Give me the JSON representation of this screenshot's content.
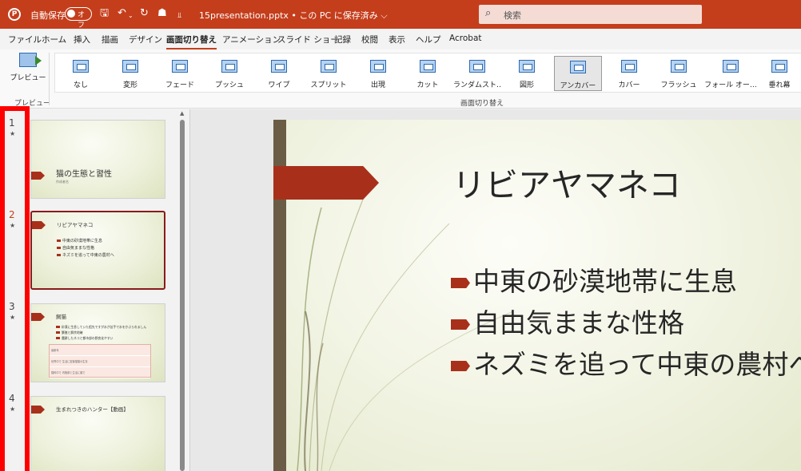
{
  "titlebar": {
    "logo": "P",
    "autosave_label": "自動保存",
    "autosave_state": "オフ",
    "save_icon": "save-icon",
    "undo_icon": "undo-icon",
    "redo_icon": "redo-icon",
    "filename": "15presentation.pptx • この PC に保存済み ⌵",
    "search_placeholder": "検索",
    "accent": "#c43e1c"
  },
  "tabs": [
    {
      "label": "ファイル"
    },
    {
      "label": "ホーム"
    },
    {
      "label": "挿入"
    },
    {
      "label": "描画"
    },
    {
      "label": "デザイン"
    },
    {
      "label": "画面切り替え",
      "active": true
    },
    {
      "label": "アニメーション"
    },
    {
      "label": "スライド ショー"
    },
    {
      "label": "記録"
    },
    {
      "label": "校閲"
    },
    {
      "label": "表示"
    },
    {
      "label": "ヘルプ"
    },
    {
      "label": "Acrobat"
    }
  ],
  "ribbon": {
    "preview_label": "プレビュー",
    "preview_group": "プレビュー",
    "transitions_group": "画面切り替え",
    "transitions": [
      {
        "label": "なし"
      },
      {
        "label": "変形"
      },
      {
        "label": "フェード"
      },
      {
        "label": "プッシュ"
      },
      {
        "label": "ワイプ"
      },
      {
        "label": "スプリット"
      },
      {
        "label": "出現"
      },
      {
        "label": "カット"
      },
      {
        "label": "ランダムスト…"
      },
      {
        "label": "図形"
      },
      {
        "label": "アンカバー",
        "selected": true
      },
      {
        "label": "カバー"
      },
      {
        "label": "フラッシュ"
      },
      {
        "label": "フォール オー…"
      },
      {
        "label": "垂れ幕"
      }
    ]
  },
  "slides_panel": {
    "slides": [
      {
        "number": "1",
        "title": "猫の生態と習性",
        "subtitle": "作成者名"
      },
      {
        "number": "2",
        "title": "リビアヤマネコ",
        "bullets": [
          "中東の砂漠地帯に生息",
          "自由気ままな性格",
          "ネズミを追って中東の農村へ"
        ],
        "active": true
      },
      {
        "number": "3",
        "title": "飼猫",
        "bullets": [
          "砂漠に生息していた祖先ですが水が苦手で水をかぶられるしん",
          "繁殖と餌余地確",
          "農耕したネコと都市部の野良化やすい"
        ],
        "table": [
          "最新年",
          "世界中で 生活に密接猫猫の生存",
          "猫科中で 内陸部と生活に類で"
        ]
      },
      {
        "number": "4",
        "title": "生まれつきのハンター【動画】"
      }
    ],
    "star": "★"
  },
  "slide": {
    "title": "リビアヤマネコ",
    "bullets": [
      "中東の砂漠地帯に生息",
      "自由気ままな性格",
      "ネズミを追って中東の農村へ"
    ],
    "accent": "#a8301b",
    "bar_color": "#6b5c45"
  }
}
